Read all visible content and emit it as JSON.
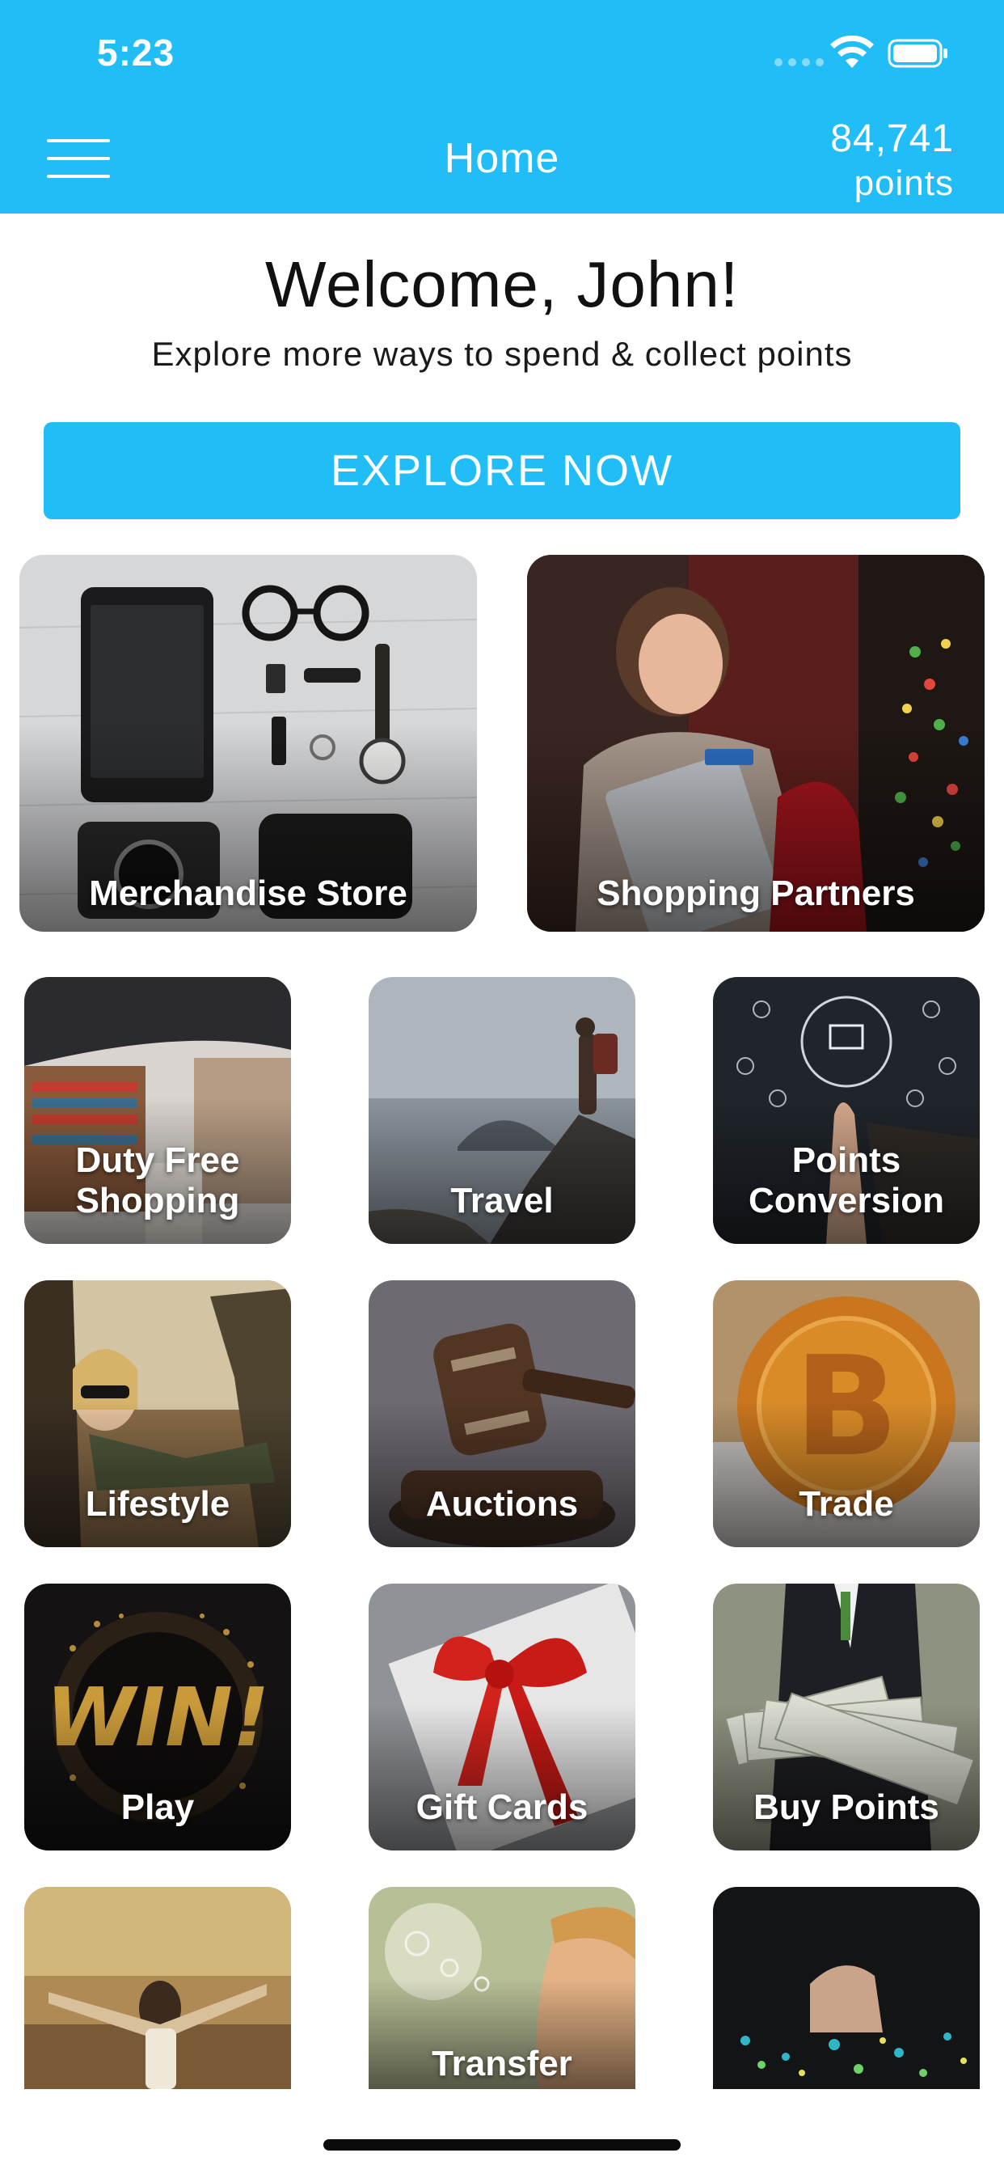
{
  "status_bar": {
    "time": "5:23"
  },
  "header": {
    "title": "Home",
    "points_value": "84,741",
    "points_unit": "points"
  },
  "welcome": {
    "heading": "Welcome, John!",
    "subtitle": "Explore more ways to spend & collect points",
    "cta_label": "EXPLORE NOW"
  },
  "featured": [
    {
      "label": "Merchandise Store"
    },
    {
      "label": "Shopping Partners"
    }
  ],
  "categories": [
    {
      "label": "Duty Free\nShopping"
    },
    {
      "label": "Travel"
    },
    {
      "label": "Points\nConversion"
    },
    {
      "label": "Lifestyle"
    },
    {
      "label": "Auctions"
    },
    {
      "label": "Trade"
    },
    {
      "label": "Play"
    },
    {
      "label": "Gift Cards"
    },
    {
      "label": "Buy Points"
    },
    {
      "label": ""
    },
    {
      "label": "Transfer"
    },
    {
      "label": ""
    }
  ],
  "colors": {
    "brand": "#21bdf6",
    "background": "#ffffff"
  }
}
